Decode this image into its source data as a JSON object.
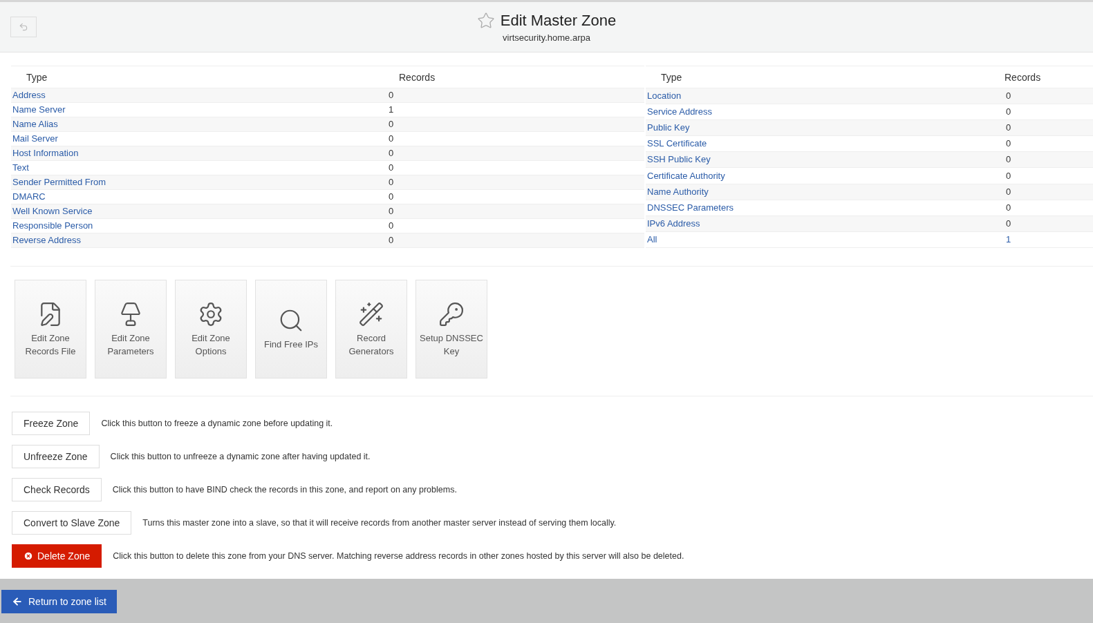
{
  "header": {
    "title": "Edit Master Zone",
    "subtitle": "virtsecurity.home.arpa",
    "favorite": false
  },
  "record_tables": [
    {
      "columns": [
        "Type",
        "Records"
      ],
      "rows": [
        {
          "type": "Address",
          "count": "0",
          "count_link": false
        },
        {
          "type": "Name Server",
          "count": "1",
          "count_link": false
        },
        {
          "type": "Name Alias",
          "count": "0",
          "count_link": false
        },
        {
          "type": "Mail Server",
          "count": "0",
          "count_link": false
        },
        {
          "type": "Host Information",
          "count": "0",
          "count_link": false
        },
        {
          "type": "Text",
          "count": "0",
          "count_link": false
        },
        {
          "type": "Sender Permitted From",
          "count": "0",
          "count_link": false
        },
        {
          "type": "DMARC",
          "count": "0",
          "count_link": false
        },
        {
          "type": "Well Known Service",
          "count": "0",
          "count_link": false
        },
        {
          "type": "Responsible Person",
          "count": "0",
          "count_link": false
        },
        {
          "type": "Reverse Address",
          "count": "0",
          "count_link": false
        }
      ]
    },
    {
      "columns": [
        "Type",
        "Records"
      ],
      "rows": [
        {
          "type": "Location",
          "count": "0",
          "count_link": false
        },
        {
          "type": "Service Address",
          "count": "0",
          "count_link": false
        },
        {
          "type": "Public Key",
          "count": "0",
          "count_link": false
        },
        {
          "type": "SSL Certificate",
          "count": "0",
          "count_link": false
        },
        {
          "type": "SSH Public Key",
          "count": "0",
          "count_link": false
        },
        {
          "type": "Certificate Authority",
          "count": "0",
          "count_link": false
        },
        {
          "type": "Name Authority",
          "count": "0",
          "count_link": false
        },
        {
          "type": "DNSSEC Parameters",
          "count": "0",
          "count_link": false
        },
        {
          "type": "IPv6 Address",
          "count": "0",
          "count_link": false
        },
        {
          "type": "All",
          "count": "1",
          "count_link": true
        }
      ]
    }
  ],
  "tools": [
    {
      "kind": "records-file",
      "label": "Edit Zone Records File"
    },
    {
      "kind": "parameters",
      "label": "Edit Zone Parameters"
    },
    {
      "kind": "options",
      "label": "Edit Zone Options"
    },
    {
      "kind": "find",
      "label": "Find Free IPs"
    },
    {
      "kind": "generators",
      "label": "Record Generators"
    },
    {
      "kind": "dnssec",
      "label": "Setup DNSSEC Key"
    }
  ],
  "actions": [
    {
      "kind": "normal",
      "label": "Freeze Zone",
      "description": "Click this button to freeze a dynamic zone before updating it."
    },
    {
      "kind": "normal",
      "label": "Unfreeze Zone",
      "description": "Click this button to unfreeze a dynamic zone after having updated it."
    },
    {
      "kind": "normal",
      "label": "Check Records",
      "description": "Click this button to have BIND check the records in this zone, and report on any problems."
    },
    {
      "kind": "normal",
      "label": "Convert to Slave Zone",
      "description": "Turns this master zone into a slave, so that it will receive records from another master server instead of serving them locally."
    },
    {
      "kind": "danger",
      "label": "Delete Zone",
      "description": "Click this button to delete this zone from your DNS server. Matching reverse address records in other zones hosted by this server will also be deleted."
    }
  ],
  "footer": {
    "return_button": "Return to zone list"
  }
}
